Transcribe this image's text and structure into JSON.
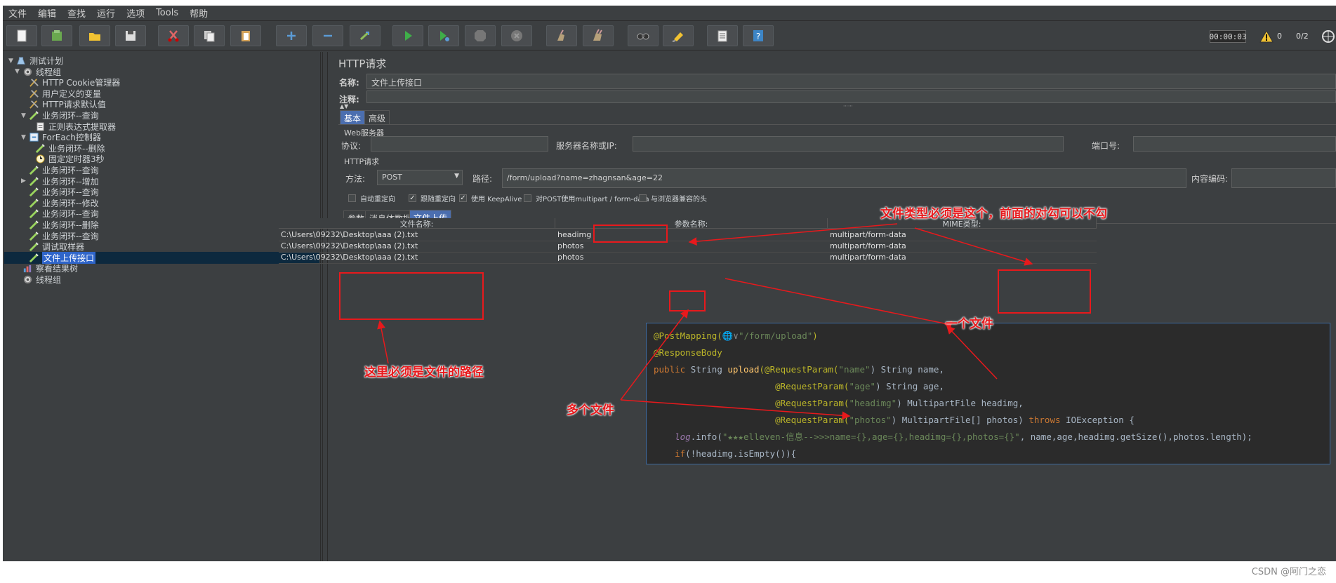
{
  "menubar": [
    "文件",
    "编辑",
    "查找",
    "运行",
    "选项",
    "Tools",
    "帮助"
  ],
  "toolbar": {
    "icons": [
      "new-icon",
      "templates-icon",
      "open-icon",
      "save-icon",
      "cut-icon",
      "copy-icon",
      "paste-icon",
      "expand-icon",
      "collapse-icon",
      "toggle-icon",
      "start-icon",
      "start-no-pause-icon",
      "stop-icon",
      "shutdown-icon",
      "clear-icon",
      "clear-all-icon",
      "search-icon",
      "reset-search-icon",
      "function-helper-icon",
      "help-icon"
    ],
    "timer": "00:00:03",
    "warnings": "0",
    "threads": "0/2"
  },
  "tree": [
    {
      "label": "测试计划",
      "icon": "test-plan-icon",
      "arrow": "▼",
      "level": 0
    },
    {
      "label": "线程组",
      "icon": "thread-group-icon",
      "arrow": "▼",
      "level": 1
    },
    {
      "label": "HTTP Cookie管理器",
      "icon": "config-icon",
      "arrow": "",
      "level": 2
    },
    {
      "label": "用户定义的变量",
      "icon": "config-icon",
      "arrow": "",
      "level": 2
    },
    {
      "label": "HTTP请求默认值",
      "icon": "config-icon",
      "arrow": "",
      "level": 2
    },
    {
      "label": "业务闭环--查询",
      "icon": "sampler-icon",
      "arrow": "▼",
      "level": 2
    },
    {
      "label": "正则表达式提取器",
      "icon": "extractor-icon",
      "arrow": "",
      "level": 3
    },
    {
      "label": "ForEach控制器",
      "icon": "controller-icon",
      "arrow": "▼",
      "level": 2
    },
    {
      "label": "业务闭环--删除",
      "icon": "sampler-icon",
      "arrow": "",
      "level": 3
    },
    {
      "label": "固定定时器3秒",
      "icon": "timer-icon",
      "arrow": "",
      "level": 3
    },
    {
      "label": "业务闭环--查询",
      "icon": "sampler-icon",
      "arrow": "",
      "level": 2
    },
    {
      "label": "业务闭环--增加",
      "icon": "sampler-icon",
      "arrow": "▶",
      "level": 2
    },
    {
      "label": "业务闭环--查询",
      "icon": "sampler-icon",
      "arrow": "",
      "level": 2
    },
    {
      "label": "业务闭环--修改",
      "icon": "sampler-icon",
      "arrow": "",
      "level": 2
    },
    {
      "label": "业务闭环--查询",
      "icon": "sampler-icon",
      "arrow": "",
      "level": 2
    },
    {
      "label": "业务闭环--删除",
      "icon": "sampler-icon",
      "arrow": "",
      "level": 2
    },
    {
      "label": "业务闭环--查询",
      "icon": "sampler-icon",
      "arrow": "",
      "level": 2
    },
    {
      "label": "调试取样器",
      "icon": "sampler-icon",
      "arrow": "",
      "level": 2
    },
    {
      "label": "文件上传接口",
      "icon": "sampler-icon",
      "arrow": "",
      "level": 2,
      "selected": true
    },
    {
      "label": "察看结果树",
      "icon": "listener-icon",
      "arrow": "",
      "level": 1
    },
    {
      "label": "线程组",
      "icon": "thread-group-icon",
      "arrow": "",
      "level": 1
    }
  ],
  "panel": {
    "title": "HTTP请求",
    "name_label": "名称:",
    "name_value": "文件上传接口",
    "comment_label": "注释:",
    "tabs": [
      "基本",
      "高级"
    ],
    "web_server_section": "Web服务器",
    "protocol_label": "协议:",
    "server_label": "服务器名称或IP:",
    "port_label": "端口号:",
    "http_section": "HTTP请求",
    "method_label": "方法:",
    "method_value": "POST",
    "path_label": "路径:",
    "path_value": "/form/upload?name=zhagnsan&age=22",
    "encoding_label": "内容编码:",
    "checkboxes": [
      {
        "label": "自动重定向",
        "checked": false
      },
      {
        "label": "跟随重定向",
        "checked": true
      },
      {
        "label": "使用 KeepAlive",
        "checked": true
      },
      {
        "label": "对POST使用multipart / form-data",
        "checked": false
      },
      {
        "label": "与浏览器兼容的头",
        "checked": false
      }
    ],
    "subtabs": [
      "参数",
      "消息体数据",
      "文件上传"
    ],
    "file_table": {
      "headers": [
        "文件名称:",
        "参数名称:",
        "MIME类型:"
      ],
      "rows": [
        [
          "C:\\Users\\09232\\Desktop\\aaa (2).txt",
          "headimg",
          "multipart/form-data"
        ],
        [
          "C:\\Users\\09232\\Desktop\\aaa (2).txt",
          "photos",
          "multipart/form-data"
        ],
        [
          "C:\\Users\\09232\\Desktop\\aaa (2).txt",
          "photos",
          "multipart/form-data"
        ]
      ]
    }
  },
  "code": {
    "line1_ann": "@PostMapping(",
    "line1_globe": "🌐∨",
    "line1_str": "\"/form/upload\"",
    "line1_end": ")",
    "line2": "@ResponseBody",
    "line3_kw": "public ",
    "line3_type": "String ",
    "line3_mth": "upload",
    "line3_ann": "(@RequestParam(",
    "line3_str": "\"name\"",
    "line3_rest": ") String name,",
    "line4_ann": "@RequestParam(",
    "line4_str": "\"age\"",
    "line4_rest": ") String age,",
    "line5_ann": "@RequestParam(",
    "line5_str": "\"headimg\"",
    "line5_rest": ") MultipartFile headimg,",
    "line6_ann": "@RequestParam(",
    "line6_str": "\"photos\"",
    "line6_rest": ") MultipartFile[] photos) ",
    "line6_kw": "throws ",
    "line6_exc": "IOException {",
    "line7_var": "log",
    "line7_dot": ".info(",
    "line7_str": "\"★★★elleven-信息-->>>name={},age={},headimg={},photos={}\"",
    "line7_rest": ", name,age,headimg.getSize(),photos.length);",
    "line8_kw": "if",
    "line8_rest": "(!headimg.isEmpty()){"
  },
  "annotations": {
    "must_be_path": "这里必须是文件的路径",
    "file_type": "文件类型必须是这个，前面的对勾可以不勾",
    "one_file": "一个文件",
    "multi_files": "多个文件"
  },
  "watermark": "CSDN @阿门之恋",
  "colors": {
    "annotation": "#e8191c",
    "selected": "#2f65ca",
    "bg": "#3c3f41"
  }
}
